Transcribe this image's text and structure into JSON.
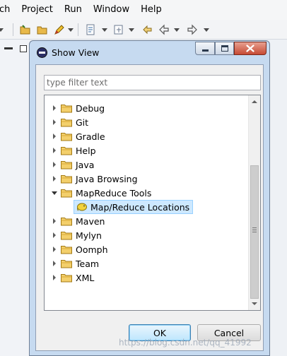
{
  "menubar": {
    "items": [
      "ch",
      "Project",
      "Run",
      "Window",
      "Help"
    ]
  },
  "toolbar": {
    "icons": [
      "open-folder-icon",
      "open-folder-icon",
      "pencil-icon",
      "outline-icon",
      "page-icon",
      "back-icon",
      "forward-icon"
    ]
  },
  "dialog": {
    "title": "Show View",
    "filter_placeholder": "type filter text",
    "filter_value": "",
    "tree": [
      {
        "label": "Debug",
        "expanded": false
      },
      {
        "label": "Git",
        "expanded": false
      },
      {
        "label": "Gradle",
        "expanded": false
      },
      {
        "label": "Help",
        "expanded": false
      },
      {
        "label": "Java",
        "expanded": false
      },
      {
        "label": "Java Browsing",
        "expanded": false
      },
      {
        "label": "MapReduce Tools",
        "expanded": true
      },
      {
        "label": "Map/Reduce Locations",
        "child": true,
        "selected": true
      },
      {
        "label": "Maven",
        "expanded": false
      },
      {
        "label": "Mylyn",
        "expanded": false
      },
      {
        "label": "Oomph",
        "expanded": false
      },
      {
        "label": "Team",
        "expanded": false
      },
      {
        "label": "XML",
        "expanded": false
      }
    ],
    "ok_label": "OK",
    "cancel_label": "Cancel"
  },
  "watermark": "https://blog.csdn.net/qq_41992",
  "colors": {
    "titlebar": "#c6daf0",
    "selection": "#cde8ff",
    "close_button": "#c64a34",
    "folder": "#e8b94a"
  }
}
